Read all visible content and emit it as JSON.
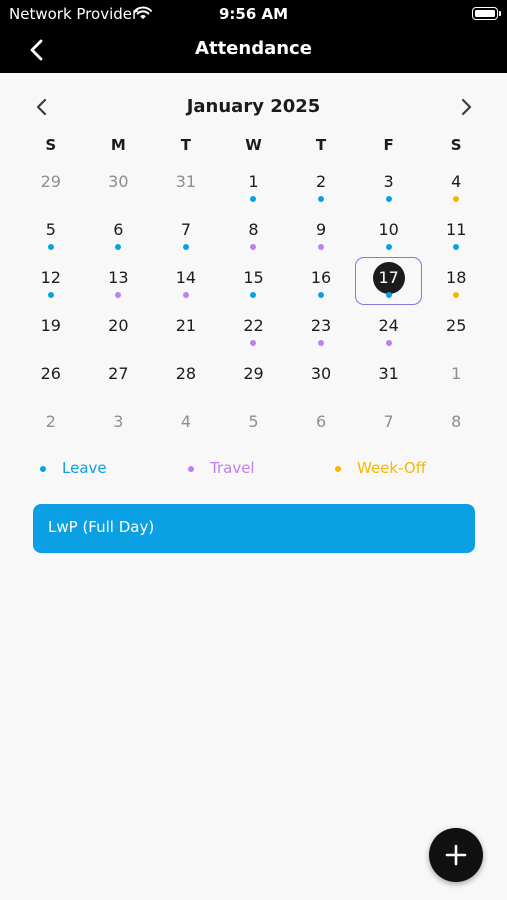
{
  "status_bar": {
    "carrier": "Network Provider",
    "time": "9:56 AM",
    "wifi_icon": "wifi-icon",
    "battery_icon": "battery-icon"
  },
  "nav": {
    "title": "Attendance",
    "back_icon": "chevron-left-icon"
  },
  "calendar": {
    "month_label": "January 2025",
    "weekdays": [
      "S",
      "M",
      "T",
      "W",
      "T",
      "F",
      "S"
    ],
    "selected_day": 17,
    "days": [
      {
        "num": "29",
        "other": true,
        "dot": null
      },
      {
        "num": "30",
        "other": true,
        "dot": null
      },
      {
        "num": "31",
        "other": true,
        "dot": null
      },
      {
        "num": "1",
        "other": false,
        "dot": "leave"
      },
      {
        "num": "2",
        "other": false,
        "dot": "leave"
      },
      {
        "num": "3",
        "other": false,
        "dot": "leave"
      },
      {
        "num": "4",
        "other": false,
        "dot": "weekoff"
      },
      {
        "num": "5",
        "other": false,
        "dot": "leave"
      },
      {
        "num": "6",
        "other": false,
        "dot": "leave"
      },
      {
        "num": "7",
        "other": false,
        "dot": "leave"
      },
      {
        "num": "8",
        "other": false,
        "dot": "travel"
      },
      {
        "num": "9",
        "other": false,
        "dot": "travel"
      },
      {
        "num": "10",
        "other": false,
        "dot": "leave"
      },
      {
        "num": "11",
        "other": false,
        "dot": "leave"
      },
      {
        "num": "12",
        "other": false,
        "dot": "leave"
      },
      {
        "num": "13",
        "other": false,
        "dot": "travel"
      },
      {
        "num": "14",
        "other": false,
        "dot": "travel"
      },
      {
        "num": "15",
        "other": false,
        "dot": "leave"
      },
      {
        "num": "16",
        "other": false,
        "dot": "leave"
      },
      {
        "num": "17",
        "other": false,
        "dot": "leave",
        "selected": true
      },
      {
        "num": "18",
        "other": false,
        "dot": "weekoff"
      },
      {
        "num": "19",
        "other": false,
        "dot": null
      },
      {
        "num": "20",
        "other": false,
        "dot": null
      },
      {
        "num": "21",
        "other": false,
        "dot": null
      },
      {
        "num": "22",
        "other": false,
        "dot": "travel"
      },
      {
        "num": "23",
        "other": false,
        "dot": "travel"
      },
      {
        "num": "24",
        "other": false,
        "dot": "travel"
      },
      {
        "num": "25",
        "other": false,
        "dot": null
      },
      {
        "num": "26",
        "other": false,
        "dot": null
      },
      {
        "num": "27",
        "other": false,
        "dot": null
      },
      {
        "num": "28",
        "other": false,
        "dot": null
      },
      {
        "num": "29",
        "other": false,
        "dot": null
      },
      {
        "num": "30",
        "other": false,
        "dot": null
      },
      {
        "num": "31",
        "other": false,
        "dot": null
      },
      {
        "num": "1",
        "other": true,
        "dot": null
      },
      {
        "num": "2",
        "other": true,
        "dot": null
      },
      {
        "num": "3",
        "other": true,
        "dot": null
      },
      {
        "num": "4",
        "other": true,
        "dot": null
      },
      {
        "num": "5",
        "other": true,
        "dot": null
      },
      {
        "num": "6",
        "other": true,
        "dot": null
      },
      {
        "num": "7",
        "other": true,
        "dot": null
      },
      {
        "num": "8",
        "other": true,
        "dot": null
      }
    ]
  },
  "legend": {
    "leave": {
      "label": "Leave",
      "color": "#0ba0e4"
    },
    "travel": {
      "label": "Travel",
      "color": "#c27ff0"
    },
    "weekoff": {
      "label": "Week-Off",
      "color": "#f5b800"
    }
  },
  "event": {
    "label": "LwP (Full Day)",
    "color": "#0ba0e4"
  },
  "fab": {
    "icon": "plus-icon"
  }
}
